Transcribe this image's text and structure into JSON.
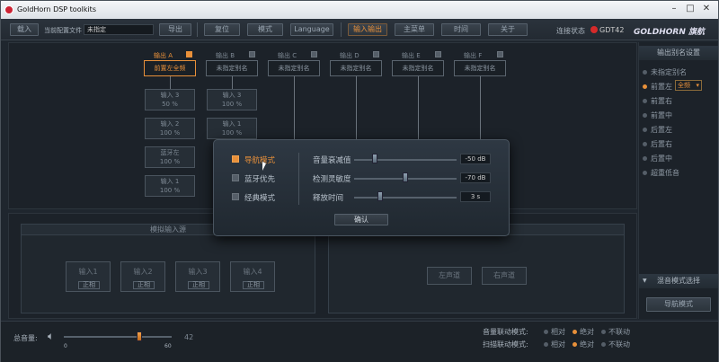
{
  "window": {
    "title": "GoldHorn DSP toolkits",
    "min": "–",
    "max": "□",
    "close": "✕"
  },
  "toolbar": {
    "import": "载入",
    "current_config_label": "当前配置文件",
    "current_config_value": "未指定",
    "export": "导出",
    "reset": "复位",
    "mode": "模式",
    "language": "Language",
    "io": "输入输出",
    "main_menu": "主菜单",
    "time": "时间",
    "about": "关于",
    "conn_label": "连接状态",
    "device": "GDT42",
    "brand": "GOLDHORN 旗航"
  },
  "outputs": [
    {
      "label": "输出 A",
      "name": "前置左全频",
      "checked": true,
      "selected": true
    },
    {
      "label": "输出 B",
      "name": "未指定别名",
      "checked": false
    },
    {
      "label": "输出 C",
      "name": "未指定别名",
      "checked": false
    },
    {
      "label": "输出 D",
      "name": "未指定别名",
      "checked": false
    },
    {
      "label": "输出 E",
      "name": "未指定别名",
      "checked": false
    },
    {
      "label": "输出 F",
      "name": "未指定别名",
      "checked": false
    }
  ],
  "mix_col1": [
    {
      "name": "输入 3",
      "val": "50 %"
    },
    {
      "name": "输入 2",
      "val": "100 %"
    },
    {
      "name": "蓝牙左",
      "val": "100 %"
    },
    {
      "name": "输入 1",
      "val": "100 %"
    }
  ],
  "mix_col2": [
    {
      "name": "输入 3",
      "val": "100 %"
    },
    {
      "name": "输入 1",
      "val": "100 %"
    }
  ],
  "right_panel": {
    "title": "输出别名设置",
    "items": [
      "未指定别名",
      "前置左",
      "前置右",
      "前置中",
      "后置左",
      "后置右",
      "后置中",
      "超重低音"
    ],
    "selected_index": 1,
    "dropdown_value": "全频",
    "mode_title": "混音模式选择",
    "nav_mode_button": "导航模式"
  },
  "lower": {
    "analog_title": "模拟输入源",
    "inputs": [
      {
        "name": "输入1",
        "sub": "正相"
      },
      {
        "name": "输入2",
        "sub": "正相"
      },
      {
        "name": "输入3",
        "sub": "正相"
      },
      {
        "name": "输入4",
        "sub": "正相"
      }
    ],
    "left_ch": "左声道",
    "right_ch": "右声道"
  },
  "bottom": {
    "master_label": "总音量:",
    "vol_min": "0",
    "vol_max": "60",
    "vol_value": "42",
    "vol_fraction": 0.7,
    "vol_link_label": "音量联动模式:",
    "scan_link_label": "扫描联动模式:",
    "opt_relative": "相对",
    "opt_absolute": "绝对",
    "opt_none": "不联动"
  },
  "dialog": {
    "mode_nav": "导航模式",
    "mode_bt": "蓝牙优先",
    "mode_classic": "经典模式",
    "atten_label": "音量衰减值",
    "atten_value": "-50",
    "atten_unit": "dB",
    "atten_fraction": 0.2,
    "sens_label": "检测灵敏度",
    "sens_value": "-70",
    "sens_unit": "dB",
    "sens_fraction": 0.5,
    "release_label": "释放时间",
    "release_value": "3",
    "release_unit": "s",
    "release_fraction": 0.25,
    "ok": "确认"
  }
}
